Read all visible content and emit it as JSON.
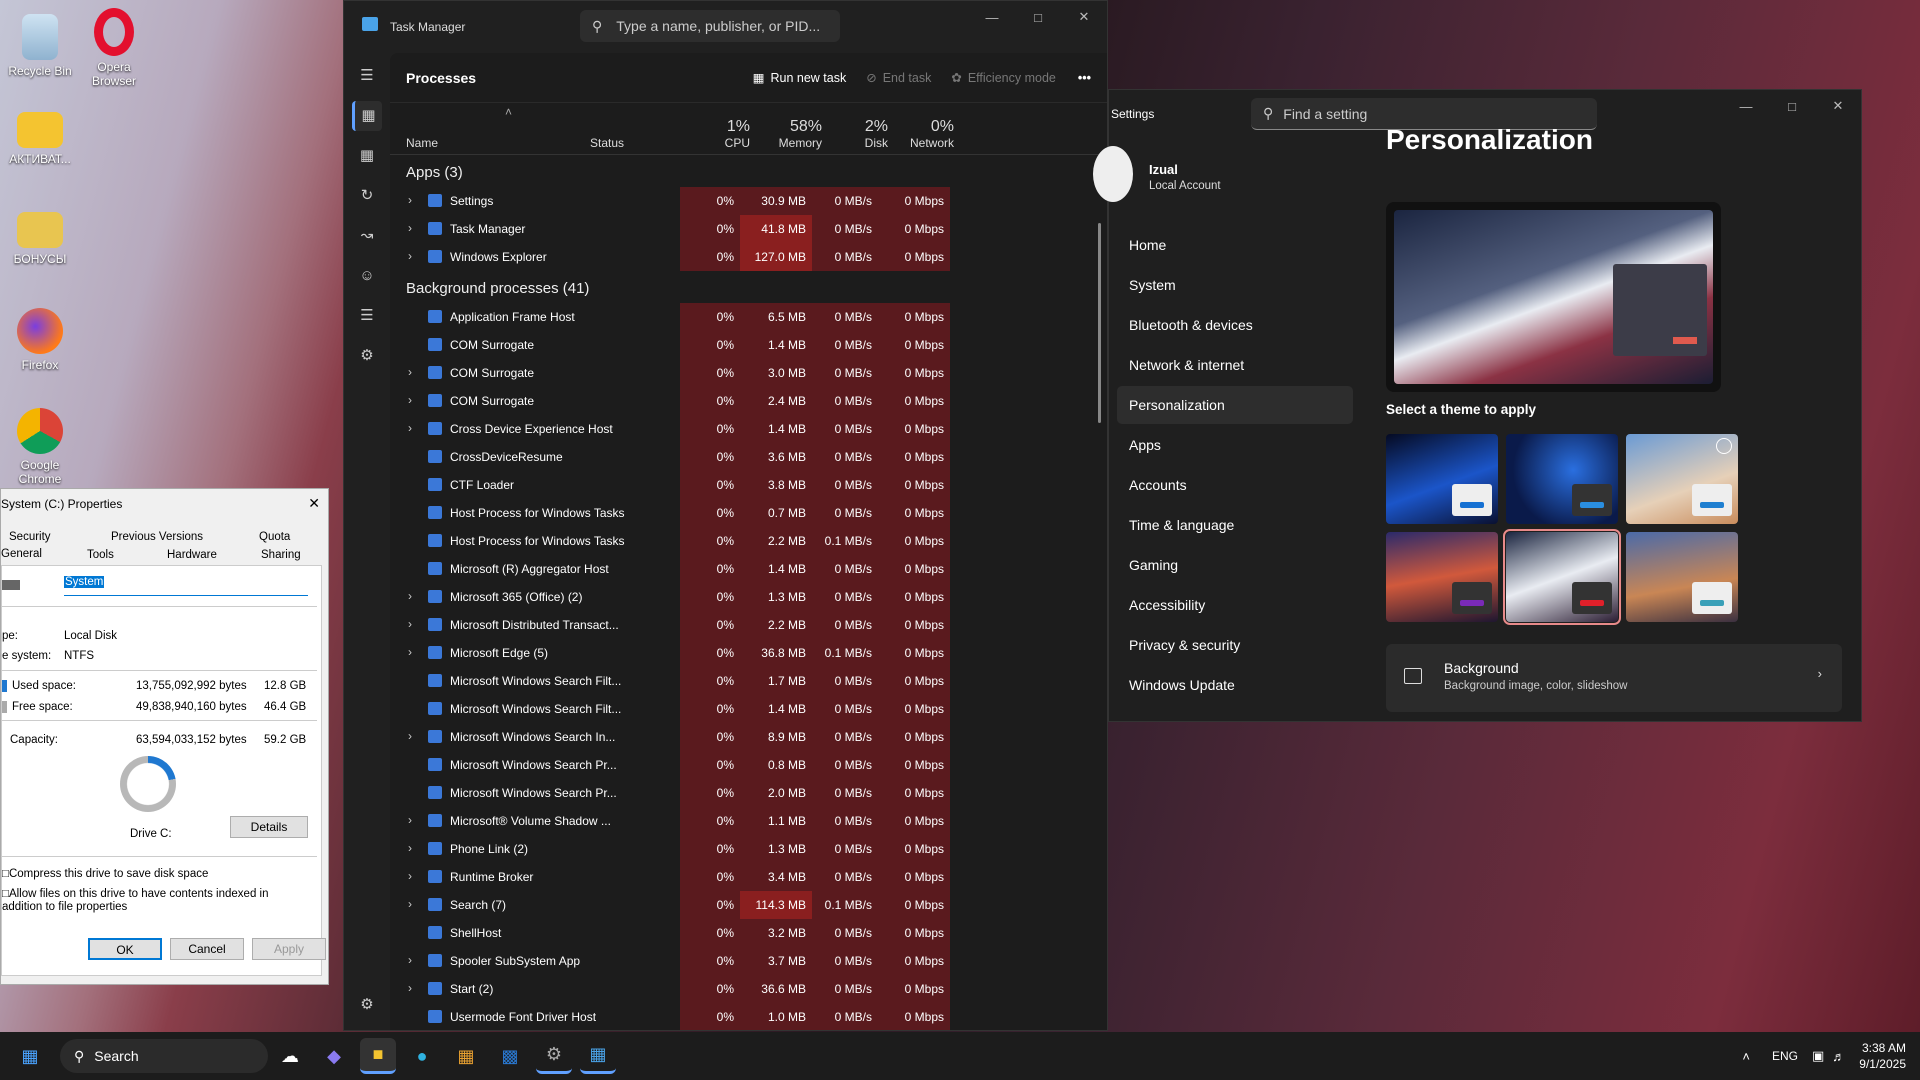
{
  "desktop": {
    "icons": [
      "Recycle Bin",
      "Opera Browser",
      "АКТИВАТ...",
      "БОНУСЫ",
      "Firefox",
      "Google Chrome"
    ]
  },
  "taskmgr": {
    "title": "Task Manager",
    "search_placeholder": "Type a name, publisher, or PID...",
    "section": "Processes",
    "run_new_task": "Run new task",
    "end_task": "End task",
    "efficiency": "Efficiency mode",
    "more": "•••",
    "cols": {
      "name": "Name",
      "status": "Status",
      "cpu": "CPU",
      "mem": "Memory",
      "disk": "Disk",
      "net": "Network"
    },
    "pcts": {
      "cpu": "1%",
      "mem": "58%",
      "disk": "2%",
      "net": "0%"
    },
    "apps_header": "Apps (3)",
    "apps": [
      {
        "name": "Settings",
        "exp": true,
        "cpu": "0%",
        "mem": "30.9 MB",
        "disk": "0 MB/s",
        "net": "0 Mbps"
      },
      {
        "name": "Task Manager",
        "exp": true,
        "cpu": "0%",
        "mem": "41.8 MB",
        "disk": "0 MB/s",
        "net": "0 Mbps",
        "hot": true
      },
      {
        "name": "Windows Explorer",
        "exp": true,
        "cpu": "0%",
        "mem": "127.0 MB",
        "disk": "0 MB/s",
        "net": "0 Mbps",
        "hot": true
      }
    ],
    "bg_header": "Background processes (41)",
    "bg": [
      {
        "name": "Application Frame Host",
        "exp": false,
        "cpu": "0%",
        "mem": "6.5 MB",
        "disk": "0 MB/s",
        "net": "0 Mbps"
      },
      {
        "name": "COM Surrogate",
        "exp": false,
        "cpu": "0%",
        "mem": "1.4 MB",
        "disk": "0 MB/s",
        "net": "0 Mbps"
      },
      {
        "name": "COM Surrogate",
        "exp": true,
        "cpu": "0%",
        "mem": "3.0 MB",
        "disk": "0 MB/s",
        "net": "0 Mbps"
      },
      {
        "name": "COM Surrogate",
        "exp": true,
        "cpu": "0%",
        "mem": "2.4 MB",
        "disk": "0 MB/s",
        "net": "0 Mbps"
      },
      {
        "name": "Cross Device Experience Host",
        "exp": true,
        "cpu": "0%",
        "mem": "1.4 MB",
        "disk": "0 MB/s",
        "net": "0 Mbps"
      },
      {
        "name": "CrossDeviceResume",
        "exp": false,
        "cpu": "0%",
        "mem": "3.6 MB",
        "disk": "0 MB/s",
        "net": "0 Mbps"
      },
      {
        "name": "CTF Loader",
        "exp": false,
        "cpu": "0%",
        "mem": "3.8 MB",
        "disk": "0 MB/s",
        "net": "0 Mbps"
      },
      {
        "name": "Host Process for Windows Tasks",
        "exp": false,
        "cpu": "0%",
        "mem": "0.7 MB",
        "disk": "0 MB/s",
        "net": "0 Mbps"
      },
      {
        "name": "Host Process for Windows Tasks",
        "exp": false,
        "cpu": "0%",
        "mem": "2.2 MB",
        "disk": "0.1 MB/s",
        "net": "0 Mbps"
      },
      {
        "name": "Microsoft (R) Aggregator Host",
        "exp": false,
        "cpu": "0%",
        "mem": "1.4 MB",
        "disk": "0 MB/s",
        "net": "0 Mbps"
      },
      {
        "name": "Microsoft 365 (Office) (2)",
        "exp": true,
        "cpu": "0%",
        "mem": "1.3 MB",
        "disk": "0 MB/s",
        "net": "0 Mbps",
        "status": "pause"
      },
      {
        "name": "Microsoft Distributed Transact...",
        "exp": true,
        "cpu": "0%",
        "mem": "2.2 MB",
        "disk": "0 MB/s",
        "net": "0 Mbps"
      },
      {
        "name": "Microsoft Edge (5)",
        "exp": true,
        "cpu": "0%",
        "mem": "36.8 MB",
        "disk": "0.1 MB/s",
        "net": "0 Mbps"
      },
      {
        "name": "Microsoft Windows Search Filt...",
        "exp": false,
        "cpu": "0%",
        "mem": "1.7 MB",
        "disk": "0 MB/s",
        "net": "0 Mbps"
      },
      {
        "name": "Microsoft Windows Search Filt...",
        "exp": false,
        "cpu": "0%",
        "mem": "1.4 MB",
        "disk": "0 MB/s",
        "net": "0 Mbps"
      },
      {
        "name": "Microsoft Windows Search In...",
        "exp": true,
        "cpu": "0%",
        "mem": "8.9 MB",
        "disk": "0 MB/s",
        "net": "0 Mbps"
      },
      {
        "name": "Microsoft Windows Search Pr...",
        "exp": false,
        "cpu": "0%",
        "mem": "0.8 MB",
        "disk": "0 MB/s",
        "net": "0 Mbps"
      },
      {
        "name": "Microsoft Windows Search Pr...",
        "exp": false,
        "cpu": "0%",
        "mem": "2.0 MB",
        "disk": "0 MB/s",
        "net": "0 Mbps"
      },
      {
        "name": "Microsoft® Volume Shadow ...",
        "exp": true,
        "cpu": "0%",
        "mem": "1.1 MB",
        "disk": "0 MB/s",
        "net": "0 Mbps"
      },
      {
        "name": "Phone Link (2)",
        "exp": true,
        "cpu": "0%",
        "mem": "1.3 MB",
        "disk": "0 MB/s",
        "net": "0 Mbps",
        "status": "pause"
      },
      {
        "name": "Runtime Broker",
        "exp": true,
        "cpu": "0%",
        "mem": "3.4 MB",
        "disk": "0 MB/s",
        "net": "0 Mbps"
      },
      {
        "name": "Search (7)",
        "exp": true,
        "cpu": "0%",
        "mem": "114.3 MB",
        "disk": "0.1 MB/s",
        "net": "0 Mbps",
        "hot": true
      },
      {
        "name": "ShellHost",
        "exp": false,
        "cpu": "0%",
        "mem": "3.2 MB",
        "disk": "0 MB/s",
        "net": "0 Mbps"
      },
      {
        "name": "Spooler SubSystem App",
        "exp": true,
        "cpu": "0%",
        "mem": "3.7 MB",
        "disk": "0 MB/s",
        "net": "0 Mbps"
      },
      {
        "name": "Start (2)",
        "exp": true,
        "cpu": "0%",
        "mem": "36.6 MB",
        "disk": "0 MB/s",
        "net": "0 Mbps"
      },
      {
        "name": "Usermode Font Driver Host",
        "exp": false,
        "cpu": "0%",
        "mem": "1.0 MB",
        "disk": "0 MB/s",
        "net": "0 Mbps"
      }
    ]
  },
  "settings": {
    "title": "Settings",
    "search": "Find a setting",
    "user": "Izual",
    "account": "Local Account",
    "nav": [
      "Home",
      "System",
      "Bluetooth & devices",
      "Network & internet",
      "Personalization",
      "Apps",
      "Accounts",
      "Time & language",
      "Gaming",
      "Accessibility",
      "Privacy & security",
      "Windows Update"
    ],
    "heading": "Personalization",
    "theme_label": "Select a theme to apply",
    "bg_title": "Background",
    "bg_sub": "Background image, color, slideshow"
  },
  "props": {
    "title": "System (C:) Properties",
    "tabs_top": [
      "Security",
      "Previous Versions",
      "Quota"
    ],
    "tabs_bottom": [
      "General",
      "Tools",
      "Hardware",
      "Sharing"
    ],
    "name": "System",
    "type_lbl": "pe:",
    "type_val": "Local Disk",
    "fs_lbl": "e system:",
    "fs_val": "NTFS",
    "used_lbl": "Used space:",
    "used_bytes": "13,755,092,992 bytes",
    "used_gb": "12.8 GB",
    "free_lbl": "Free space:",
    "free_bytes": "49,838,940,160 bytes",
    "free_gb": "46.4 GB",
    "cap_lbl": "Capacity:",
    "cap_bytes": "63,594,033,152 bytes",
    "cap_gb": "59.2 GB",
    "drive": "Drive C:",
    "details": "Details",
    "compress": "Compress this drive to save disk space",
    "index": "Allow files on this drive to have contents indexed in addition to file properties",
    "ok": "OK",
    "cancel": "Cancel",
    "apply": "Apply",
    "used_fraction": 0.22
  },
  "taskbar": {
    "search": "Search",
    "lang": "ENG",
    "time": "3:38 AM",
    "date": "9/1/2025"
  }
}
